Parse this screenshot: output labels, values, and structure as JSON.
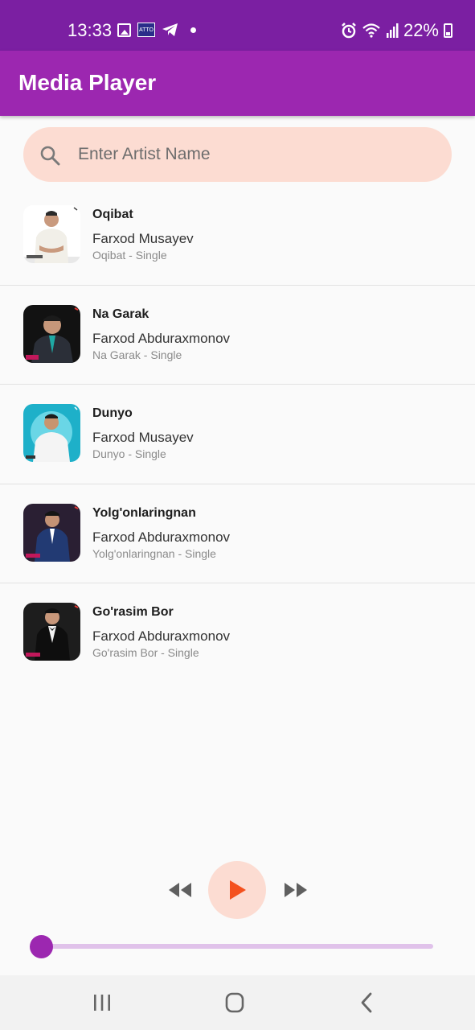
{
  "status_bar": {
    "time": "13:33",
    "battery": "22%",
    "notification_icons": [
      "image-icon",
      "atto-icon",
      "telegram-icon",
      "dot-icon"
    ],
    "system_icons": [
      "alarm-icon",
      "wifi-icon",
      "signal-icon",
      "battery-icon"
    ],
    "atto_label": "ATTO"
  },
  "app_bar": {
    "title": "Media Player"
  },
  "search": {
    "placeholder": "Enter Artist Name",
    "value": ""
  },
  "songs": [
    {
      "title": "Oqibat",
      "artist": "Farxod Musayev",
      "album": "Oqibat - Single"
    },
    {
      "title": "Na Garak",
      "artist": "Farxod Abduraxmonov",
      "album": "Na Garak - Single"
    },
    {
      "title": "Dunyo",
      "artist": "Farxod Musayev",
      "album": "Dunyo - Single"
    },
    {
      "title": "Yolg'onlaringnan",
      "artist": "Farxod Abduraxmonov",
      "album": "Yolg'onlaringnan - Single"
    },
    {
      "title": "Go'rasim Bor",
      "artist": "Farxod Abduraxmonov",
      "album": "Go'rasim Bor - Single"
    }
  ],
  "player": {
    "progress_fraction": 0.0,
    "controls": [
      "rewind-icon",
      "play-icon",
      "fast-forward-icon"
    ]
  },
  "nav_bar": {
    "buttons": [
      "recent-apps-icon",
      "home-icon",
      "back-icon"
    ]
  },
  "colors": {
    "status_bar": "#7b1fa2",
    "app_bar": "#9c27b0",
    "accent": "#9c27b0",
    "search_bg": "#fcdcd2",
    "play_icon": "#f4511e",
    "background": "#fafafa"
  }
}
